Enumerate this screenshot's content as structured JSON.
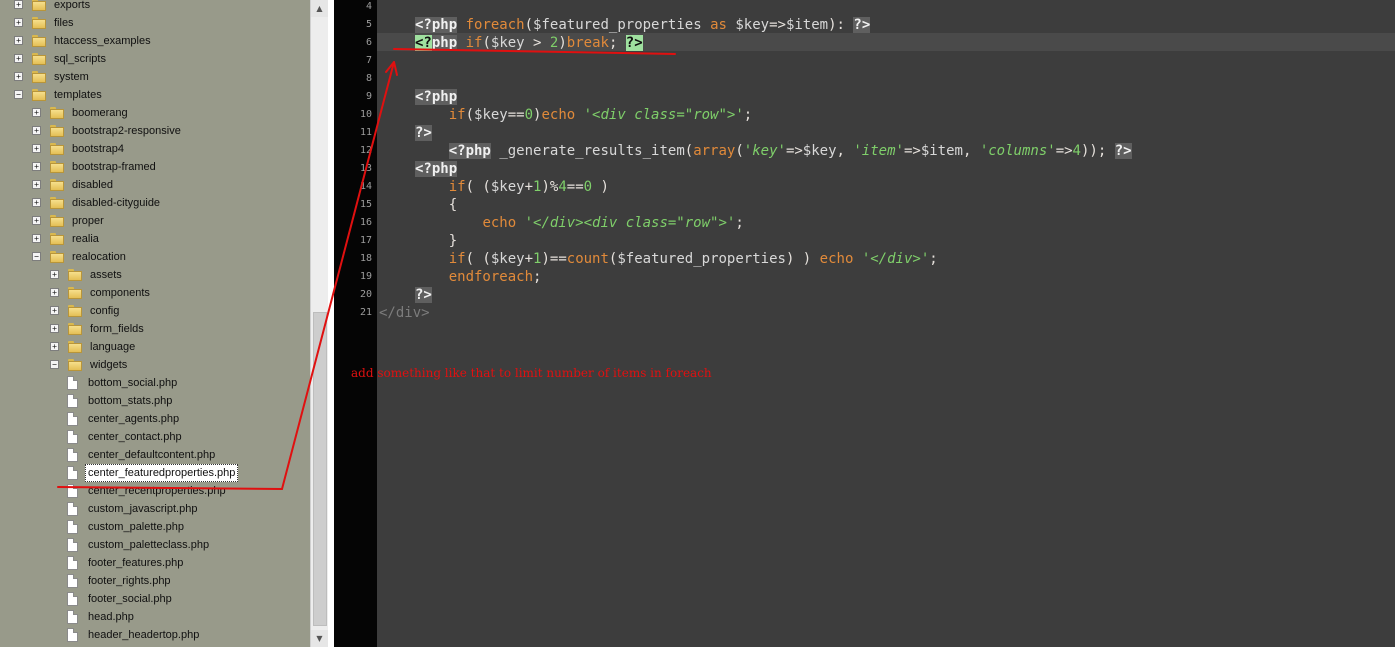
{
  "tree": {
    "rows": [
      {
        "label": "exports",
        "type": "folder",
        "level": 0,
        "expander": "plus"
      },
      {
        "label": "files",
        "type": "folder",
        "level": 0,
        "expander": "plus"
      },
      {
        "label": "htaccess_examples",
        "type": "folder",
        "level": 0,
        "expander": "plus"
      },
      {
        "label": "sql_scripts",
        "type": "folder",
        "level": 0,
        "expander": "plus"
      },
      {
        "label": "system",
        "type": "folder",
        "level": 0,
        "expander": "plus"
      },
      {
        "label": "templates",
        "type": "folder",
        "level": 0,
        "expander": "minus"
      },
      {
        "label": "boomerang",
        "type": "folder",
        "level": 1,
        "expander": "plus"
      },
      {
        "label": "bootstrap2-responsive",
        "type": "folder",
        "level": 1,
        "expander": "plus"
      },
      {
        "label": "bootstrap4",
        "type": "folder",
        "level": 1,
        "expander": "plus"
      },
      {
        "label": "bootstrap-framed",
        "type": "folder",
        "level": 1,
        "expander": "plus"
      },
      {
        "label": "disabled",
        "type": "folder",
        "level": 1,
        "expander": "plus"
      },
      {
        "label": "disabled-cityguide",
        "type": "folder",
        "level": 1,
        "expander": "plus"
      },
      {
        "label": "proper",
        "type": "folder",
        "level": 1,
        "expander": "plus"
      },
      {
        "label": "realia",
        "type": "folder",
        "level": 1,
        "expander": "plus"
      },
      {
        "label": "realocation",
        "type": "folder",
        "level": 1,
        "expander": "minus"
      },
      {
        "label": "assets",
        "type": "folder",
        "level": 2,
        "expander": "plus"
      },
      {
        "label": "components",
        "type": "folder",
        "level": 2,
        "expander": "plus"
      },
      {
        "label": "config",
        "type": "folder",
        "level": 2,
        "expander": "plus"
      },
      {
        "label": "form_fields",
        "type": "folder",
        "level": 2,
        "expander": "plus"
      },
      {
        "label": "language",
        "type": "folder",
        "level": 2,
        "expander": "plus"
      },
      {
        "label": "widgets",
        "type": "folder",
        "level": 2,
        "expander": "minus"
      },
      {
        "label": "bottom_social.php",
        "type": "file",
        "level": 3
      },
      {
        "label": "bottom_stats.php",
        "type": "file",
        "level": 3
      },
      {
        "label": "center_agents.php",
        "type": "file",
        "level": 3
      },
      {
        "label": "center_contact.php",
        "type": "file",
        "level": 3
      },
      {
        "label": "center_defaultcontent.php",
        "type": "file",
        "level": 3
      },
      {
        "label": "center_featuredproperties.php",
        "type": "file",
        "level": 3,
        "selected": true
      },
      {
        "label": "center_recentproperties.php",
        "type": "file",
        "level": 3
      },
      {
        "label": "custom_javascript.php",
        "type": "file",
        "level": 3
      },
      {
        "label": "custom_palette.php",
        "type": "file",
        "level": 3
      },
      {
        "label": "custom_paletteclass.php",
        "type": "file",
        "level": 3
      },
      {
        "label": "footer_features.php",
        "type": "file",
        "level": 3
      },
      {
        "label": "footer_rights.php",
        "type": "file",
        "level": 3
      },
      {
        "label": "footer_social.php",
        "type": "file",
        "level": 3
      },
      {
        "label": "head.php",
        "type": "file",
        "level": 3
      },
      {
        "label": "header_headertop.php",
        "type": "file",
        "level": 3
      }
    ]
  },
  "editor": {
    "line_numbers": [
      "4",
      "5",
      "6",
      "7",
      "8",
      "9",
      "10",
      "11",
      "12",
      "13",
      "14",
      "15",
      "16",
      "17",
      "18",
      "19",
      "20",
      "21"
    ],
    "lines": [
      [],
      [
        {
          "t": "<?php",
          "c": "tag"
        },
        {
          "t": " ",
          "c": "plain"
        },
        {
          "t": "foreach",
          "c": "kw"
        },
        {
          "t": "(",
          "c": "plain"
        },
        {
          "t": "$featured_properties",
          "c": "var"
        },
        {
          "t": " ",
          "c": "plain"
        },
        {
          "t": "as",
          "c": "kw"
        },
        {
          "t": " ",
          "c": "plain"
        },
        {
          "t": "$key",
          "c": "var"
        },
        {
          "t": "=>",
          "c": "plain"
        },
        {
          "t": "$item",
          "c": "var"
        },
        {
          "t": "): ",
          "c": "plain"
        },
        {
          "t": "?>",
          "c": "tag"
        }
      ],
      [
        {
          "t": "<?",
          "c": "hl"
        },
        {
          "t": "php",
          "c": "tag"
        },
        {
          "t": " ",
          "c": "plain"
        },
        {
          "t": "if",
          "c": "kw"
        },
        {
          "t": "(",
          "c": "plain"
        },
        {
          "t": "$key",
          "c": "var"
        },
        {
          "t": " > ",
          "c": "plain"
        },
        {
          "t": "2",
          "c": "num"
        },
        {
          "t": ")",
          "c": "plain"
        },
        {
          "t": "break",
          "c": "kw"
        },
        {
          "t": "; ",
          "c": "plain"
        },
        {
          "t": "?>",
          "c": "hl"
        }
      ],
      [],
      [],
      [
        {
          "t": "<?php",
          "c": "tag"
        }
      ],
      [
        {
          "t": "    ",
          "c": "plain"
        },
        {
          "t": "if",
          "c": "kw"
        },
        {
          "t": "(",
          "c": "plain"
        },
        {
          "t": "$key",
          "c": "var"
        },
        {
          "t": "==",
          "c": "plain"
        },
        {
          "t": "0",
          "c": "num"
        },
        {
          "t": ")",
          "c": "plain"
        },
        {
          "t": "echo",
          "c": "kw"
        },
        {
          "t": " ",
          "c": "plain"
        },
        {
          "t": "'<div class=\"row\">'",
          "c": "str"
        },
        {
          "t": ";",
          "c": "plain"
        }
      ],
      [
        {
          "t": "?>",
          "c": "tag"
        }
      ],
      [
        {
          "t": "    ",
          "c": "plain"
        },
        {
          "t": "<?php",
          "c": "tag"
        },
        {
          "t": " ",
          "c": "plain"
        },
        {
          "t": "_generate_results_item",
          "c": "var"
        },
        {
          "t": "(",
          "c": "plain"
        },
        {
          "t": "array",
          "c": "fn"
        },
        {
          "t": "(",
          "c": "plain"
        },
        {
          "t": "'key'",
          "c": "str"
        },
        {
          "t": "=>",
          "c": "plain"
        },
        {
          "t": "$key",
          "c": "var"
        },
        {
          "t": ", ",
          "c": "plain"
        },
        {
          "t": "'item'",
          "c": "str"
        },
        {
          "t": "=>",
          "c": "plain"
        },
        {
          "t": "$item",
          "c": "var"
        },
        {
          "t": ", ",
          "c": "plain"
        },
        {
          "t": "'columns'",
          "c": "str"
        },
        {
          "t": "=>",
          "c": "plain"
        },
        {
          "t": "4",
          "c": "num"
        },
        {
          "t": ")); ",
          "c": "plain"
        },
        {
          "t": "?>",
          "c": "tag"
        }
      ],
      [
        {
          "t": "<?php",
          "c": "tag"
        }
      ],
      [
        {
          "t": "    ",
          "c": "plain"
        },
        {
          "t": "if",
          "c": "kw"
        },
        {
          "t": "( (",
          "c": "plain"
        },
        {
          "t": "$key",
          "c": "var"
        },
        {
          "t": "+",
          "c": "plain"
        },
        {
          "t": "1",
          "c": "num"
        },
        {
          "t": ")%",
          "c": "plain"
        },
        {
          "t": "4",
          "c": "num"
        },
        {
          "t": "==",
          "c": "plain"
        },
        {
          "t": "0",
          "c": "num"
        },
        {
          "t": " )",
          "c": "plain"
        }
      ],
      [
        {
          "t": "    {",
          "c": "plain"
        }
      ],
      [
        {
          "t": "        ",
          "c": "plain"
        },
        {
          "t": "echo",
          "c": "kw"
        },
        {
          "t": " ",
          "c": "plain"
        },
        {
          "t": "'</div><div class=\"row\">'",
          "c": "str"
        },
        {
          "t": ";",
          "c": "plain"
        }
      ],
      [
        {
          "t": "    }",
          "c": "plain"
        }
      ],
      [
        {
          "t": "    ",
          "c": "plain"
        },
        {
          "t": "if",
          "c": "kw"
        },
        {
          "t": "( (",
          "c": "plain"
        },
        {
          "t": "$key",
          "c": "var"
        },
        {
          "t": "+",
          "c": "plain"
        },
        {
          "t": "1",
          "c": "num"
        },
        {
          "t": ")==",
          "c": "plain"
        },
        {
          "t": "count",
          "c": "fn"
        },
        {
          "t": "(",
          "c": "plain"
        },
        {
          "t": "$featured_properties",
          "c": "var"
        },
        {
          "t": ") ) ",
          "c": "plain"
        },
        {
          "t": "echo",
          "c": "kw"
        },
        {
          "t": " ",
          "c": "plain"
        },
        {
          "t": "'</div>'",
          "c": "str"
        },
        {
          "t": ";",
          "c": "plain"
        }
      ],
      [
        {
          "t": "    ",
          "c": "plain"
        },
        {
          "t": "endforeach",
          "c": "kw"
        },
        {
          "t": ";",
          "c": "plain"
        }
      ],
      [
        {
          "t": "?>",
          "c": "tag"
        }
      ],
      [
        {
          "t": "</div>",
          "c": "html"
        }
      ]
    ]
  },
  "annotation": {
    "text": "add something like that to limit number of items in foreach",
    "color": "#e01010"
  },
  "colors": {
    "tree_bg": "#989a8a",
    "editor_bg": "#3d3d3d",
    "gutter_bg": "#050505",
    "keyword": "#e18a3a",
    "string": "#7fcf6a",
    "highlight": "#9fe09f"
  }
}
